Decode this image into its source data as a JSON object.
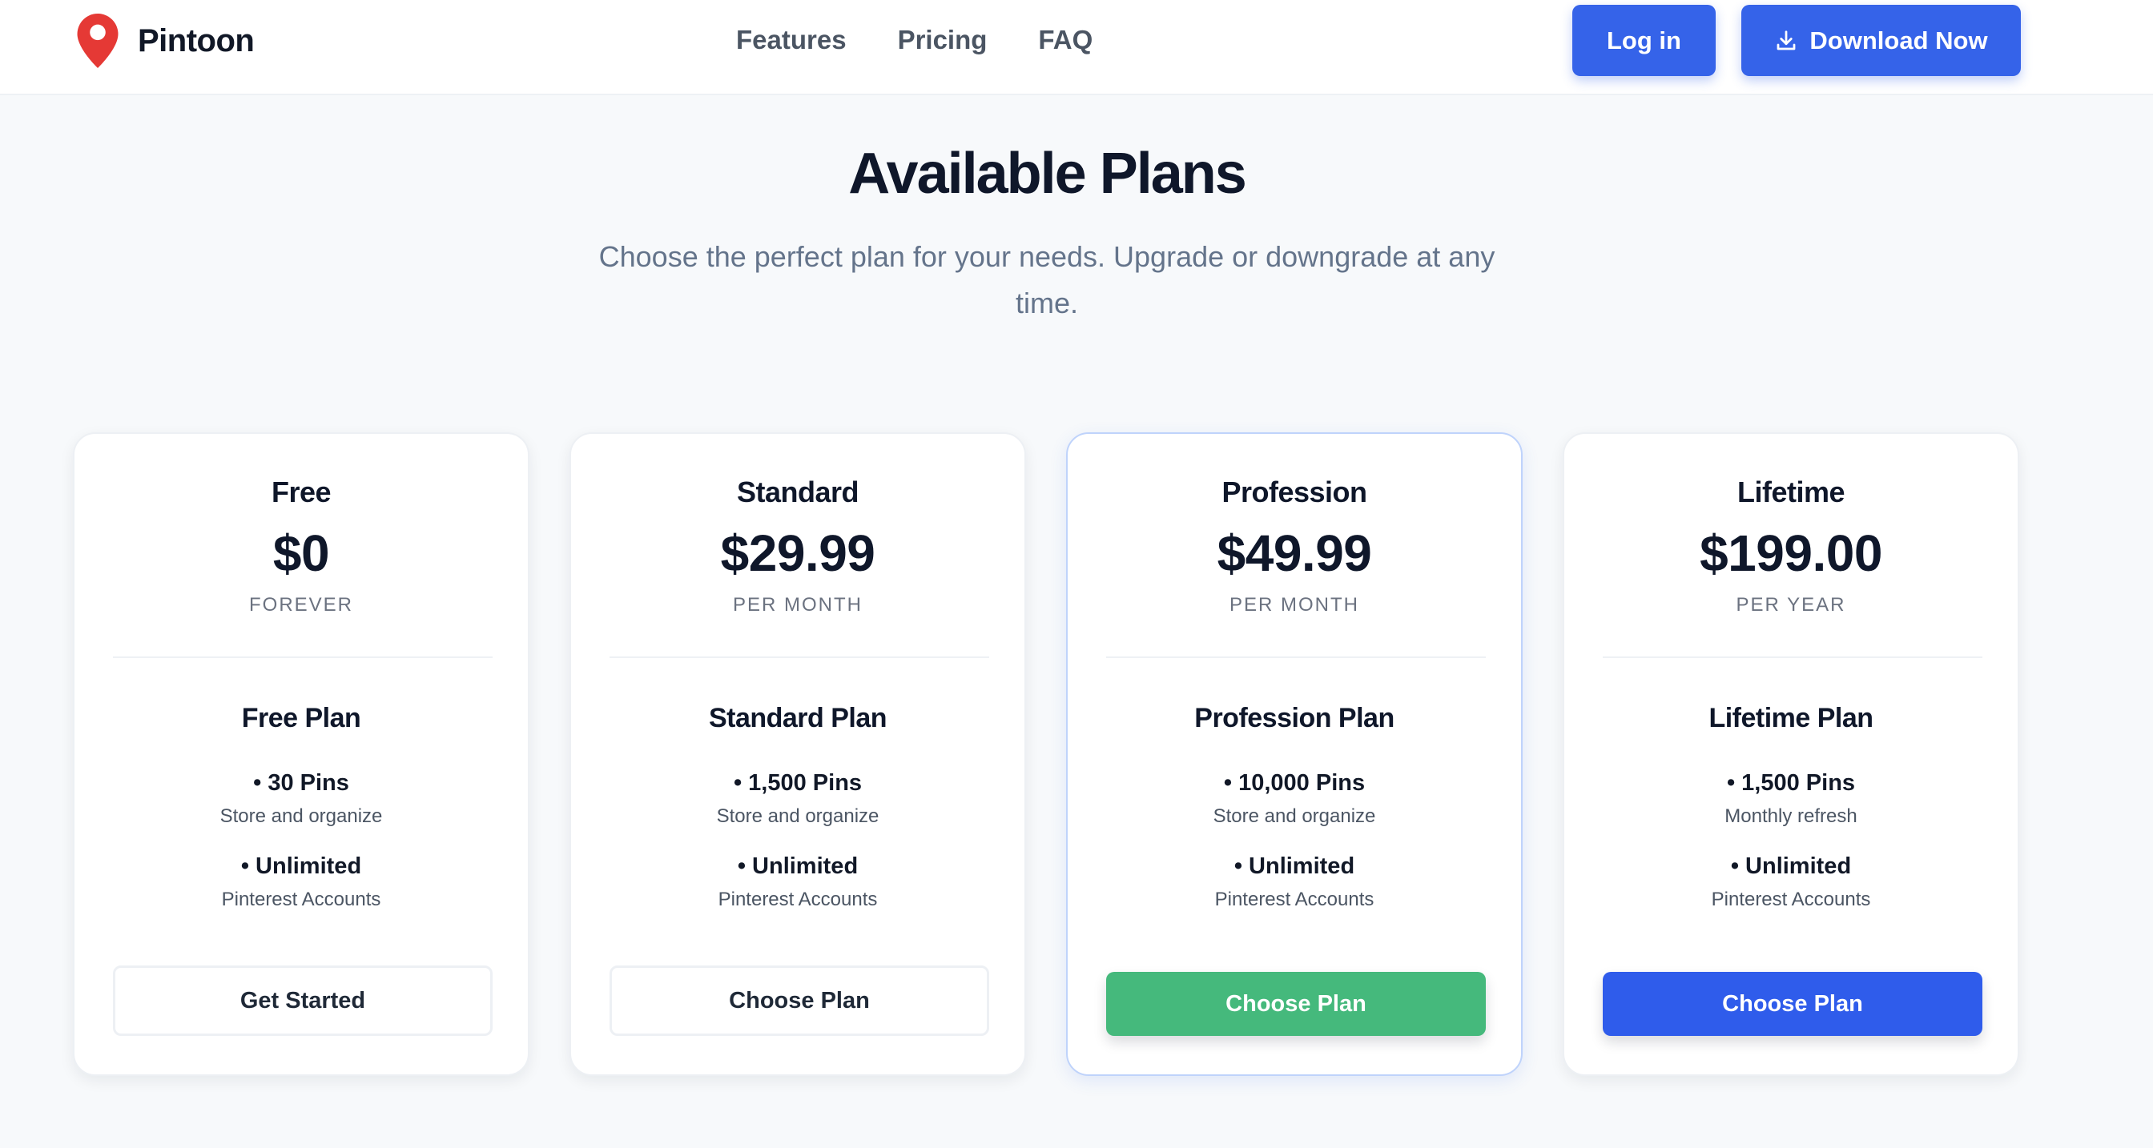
{
  "header": {
    "brand": "Pintoon",
    "nav": [
      "Features",
      "Pricing",
      "FAQ"
    ],
    "login_label": "Log in",
    "download_label": "Download Now"
  },
  "hero": {
    "title": "Available Plans",
    "subtitle": "Choose the perfect plan for your needs. Upgrade or downgrade at any time."
  },
  "plans": [
    {
      "name": "Free",
      "price": "$0",
      "period": "FOREVER",
      "plan_title": "Free Plan",
      "features": [
        {
          "title": "• 30 Pins",
          "desc": "Store and organize"
        },
        {
          "title": "• Unlimited",
          "desc": "Pinterest Accounts"
        }
      ],
      "button": "Get Started",
      "button_style": "outline"
    },
    {
      "name": "Standard",
      "price": "$29.99",
      "period": "PER MONTH",
      "plan_title": "Standard Plan",
      "features": [
        {
          "title": "• 1,500 Pins",
          "desc": "Store and organize"
        },
        {
          "title": "• Unlimited",
          "desc": "Pinterest Accounts"
        }
      ],
      "button": "Choose Plan",
      "button_style": "outline"
    },
    {
      "name": "Profession",
      "price": "$49.99",
      "period": "PER MONTH",
      "plan_title": "Profession Plan",
      "features": [
        {
          "title": "• 10,000 Pins",
          "desc": "Store and organize"
        },
        {
          "title": "• Unlimited",
          "desc": "Pinterest Accounts"
        }
      ],
      "button": "Choose Plan",
      "button_style": "solid",
      "button_color": "#45b97c"
    },
    {
      "name": "Lifetime",
      "price": "$199.00",
      "period": "PER YEAR",
      "plan_title": "Lifetime Plan",
      "features": [
        {
          "title": "• 1,500 Pins",
          "desc": "Monthly refresh"
        },
        {
          "title": "• Unlimited",
          "desc": "Pinterest Accounts"
        }
      ],
      "button": "Choose Plan",
      "button_style": "solid",
      "button_color": "#2f5ceb"
    }
  ],
  "colors": {
    "accent": "#3563e9",
    "logo_pin": "#e53935",
    "highlight_border": "#bfd3fb"
  },
  "icons": {
    "logo": "map-pin-icon",
    "download": "download-icon"
  }
}
